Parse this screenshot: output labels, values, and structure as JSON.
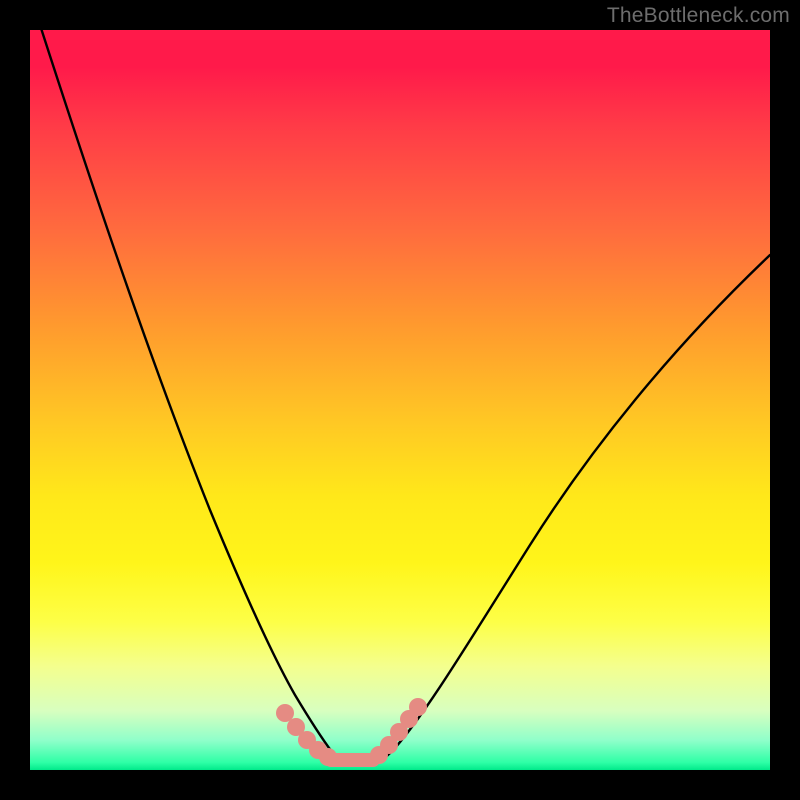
{
  "watermark": "TheBottleneck.com",
  "chart_data": {
    "type": "line",
    "title": "",
    "xlabel": "",
    "ylabel": "",
    "xlim": [
      0,
      1
    ],
    "ylim": [
      0,
      1
    ],
    "note": "Bottleneck-style V-curve on a red-to-green vertical gradient. No axis tick labels are visible in the image; values below are normalized estimates of pixel positions within the plot area.",
    "series": [
      {
        "name": "main-curve",
        "x": [
          0.0,
          0.05,
          0.1,
          0.15,
          0.2,
          0.25,
          0.3,
          0.34,
          0.37,
          0.4,
          0.44,
          0.48,
          0.52,
          0.58,
          0.65,
          0.75,
          0.85,
          0.95,
          1.0
        ],
        "y": [
          1.0,
          0.8,
          0.62,
          0.47,
          0.33,
          0.22,
          0.13,
          0.07,
          0.03,
          0.01,
          0.01,
          0.02,
          0.05,
          0.13,
          0.25,
          0.42,
          0.56,
          0.66,
          0.7
        ],
        "color": "#000000"
      },
      {
        "name": "highlight-left-dots",
        "x": [
          0.335,
          0.355,
          0.37,
          0.385,
          0.4,
          0.412
        ],
        "y": [
          0.065,
          0.045,
          0.03,
          0.018,
          0.01,
          0.008
        ],
        "color": "#e58b83"
      },
      {
        "name": "highlight-right-dots",
        "x": [
          0.47,
          0.485,
          0.5,
          0.515,
          0.53
        ],
        "y": [
          0.015,
          0.028,
          0.045,
          0.065,
          0.082
        ],
        "color": "#e58b83"
      }
    ],
    "gradient_stops": [
      {
        "pos": 0.0,
        "color": "#ff1a4a"
      },
      {
        "pos": 0.27,
        "color": "#ff6b3e"
      },
      {
        "pos": 0.53,
        "color": "#ffc824"
      },
      {
        "pos": 0.8,
        "color": "#fdff47"
      },
      {
        "pos": 0.96,
        "color": "#8fffca"
      },
      {
        "pos": 1.0,
        "color": "#00e98a"
      }
    ]
  }
}
